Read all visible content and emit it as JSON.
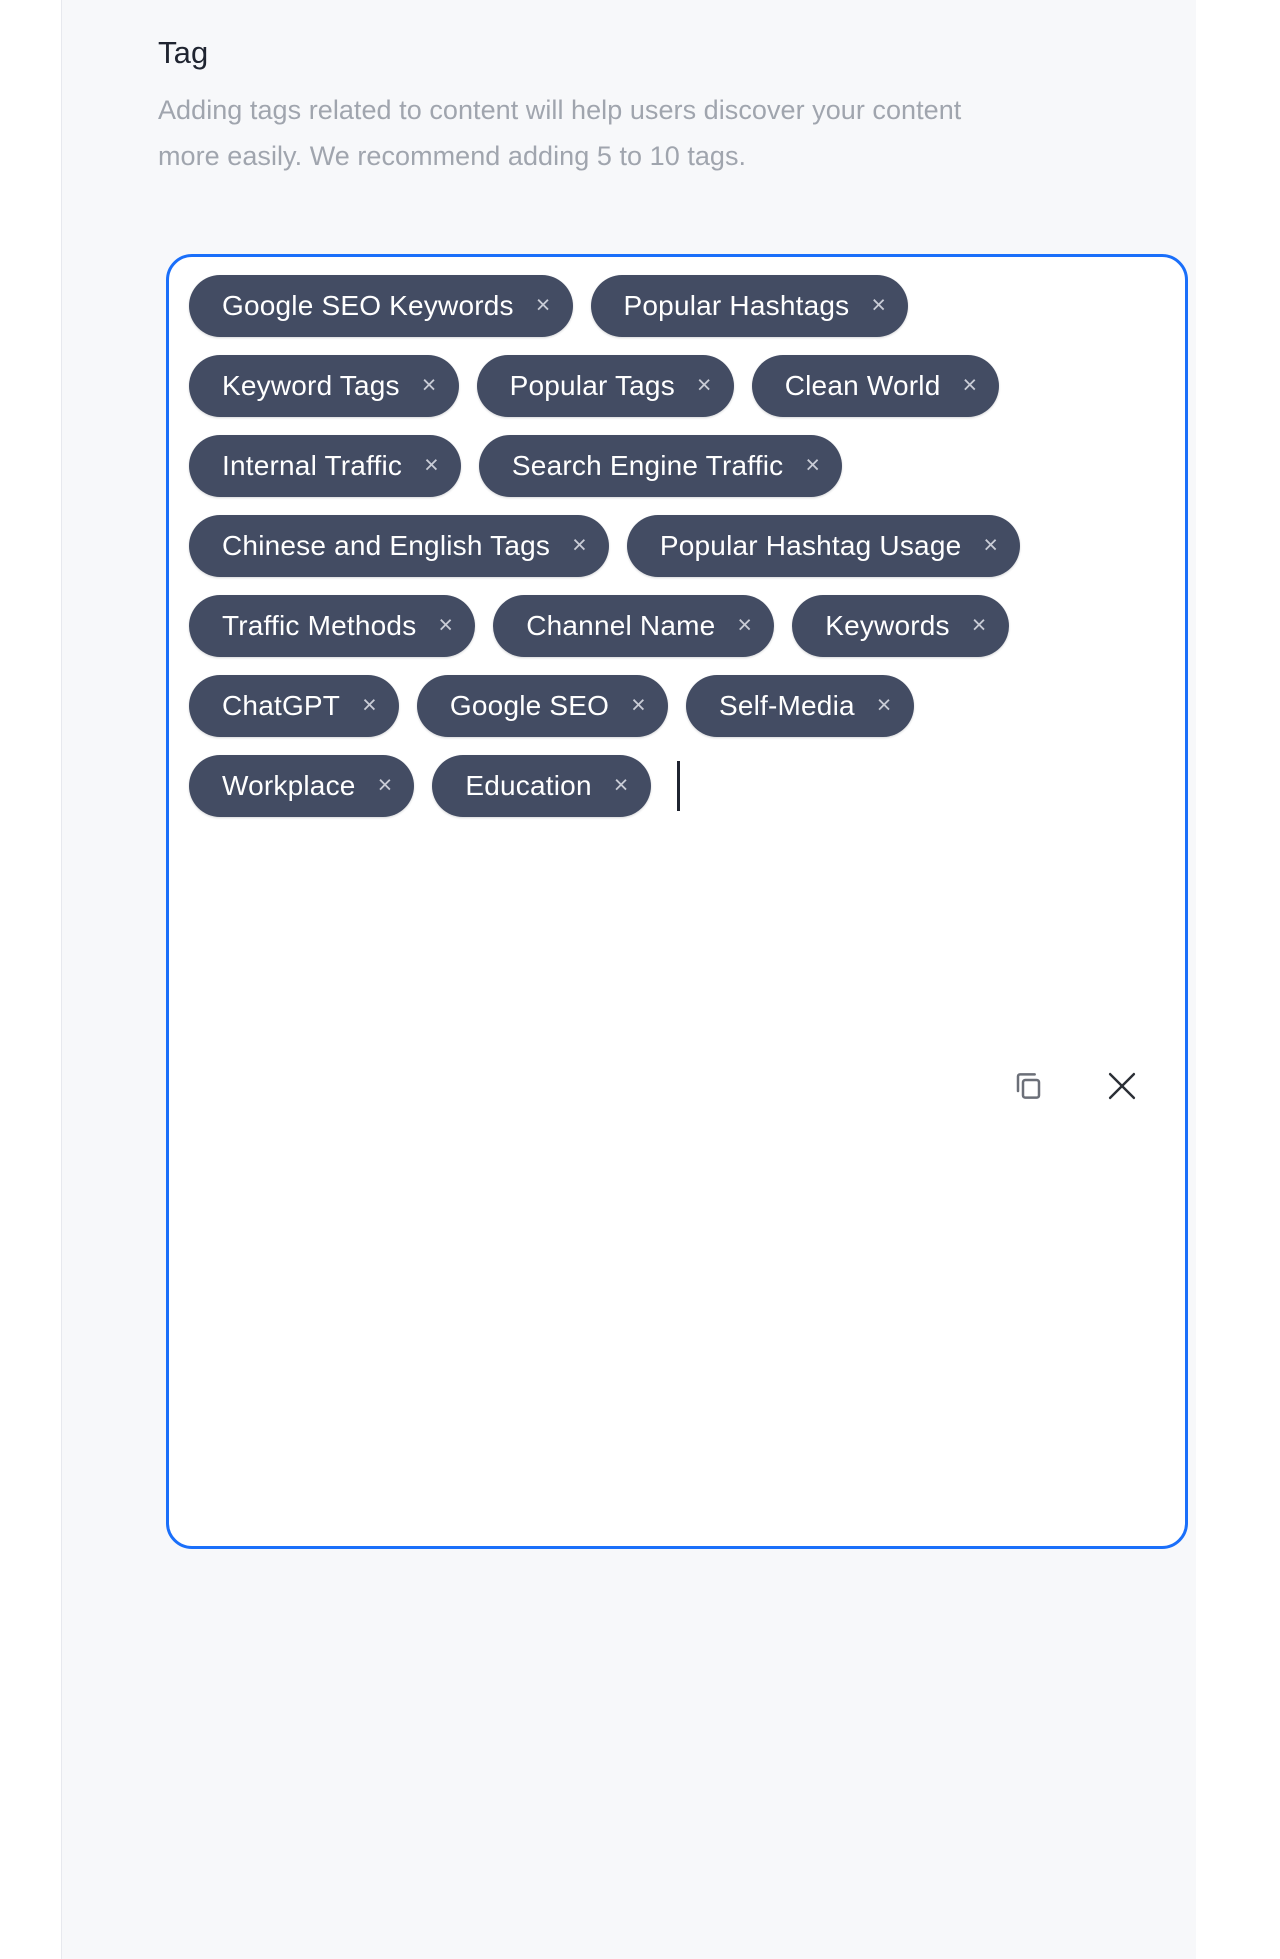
{
  "section": {
    "title": "Tag",
    "description": "Adding tags related to content will help users discover your content more easily. We recommend adding 5 to 10 tags."
  },
  "tag_input": {
    "accent_color": "#1a6ffa",
    "chip_bg": "#434c63",
    "chip_text_color": "#ffffff",
    "remove_glyph": "×",
    "caret_visible": true,
    "tags": [
      "Google SEO Keywords",
      "Popular Hashtags",
      "Keyword Tags",
      "Popular Tags",
      "Clean World",
      "Internal Traffic",
      "Search Engine Traffic",
      "Chinese and English Tags",
      "Popular Hashtag Usage",
      "Traffic Methods",
      "Channel Name",
      "Keywords",
      "ChatGPT",
      "Google SEO",
      "Self-Media",
      "Workplace",
      "Education"
    ]
  },
  "actions": [
    {
      "name": "copy-icon",
      "label": "Copy"
    },
    {
      "name": "close-icon",
      "label": "Close"
    }
  ]
}
